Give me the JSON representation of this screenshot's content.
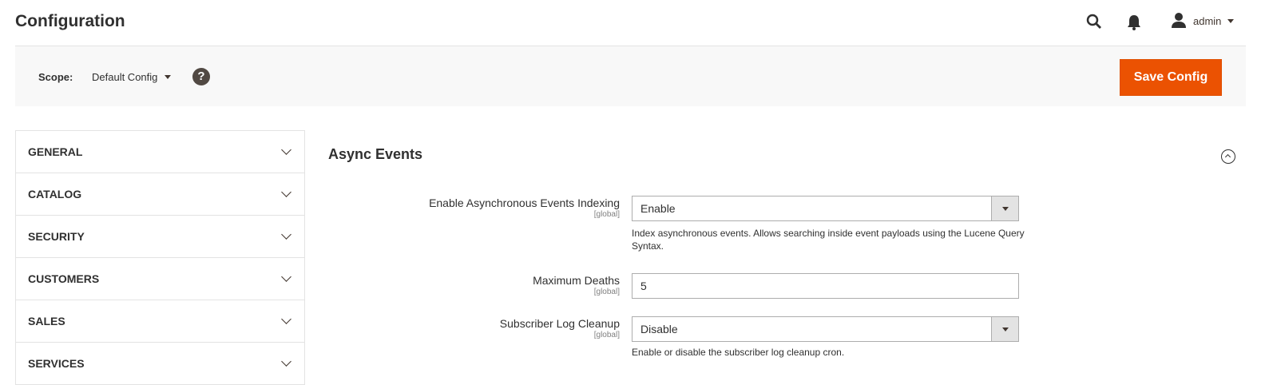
{
  "header": {
    "title": "Configuration",
    "user": "admin"
  },
  "scope": {
    "label": "Scope:",
    "value": "Default Config",
    "help": "?"
  },
  "actions": {
    "save": "Save Config"
  },
  "sidebar": {
    "items": [
      {
        "label": "GENERAL"
      },
      {
        "label": "CATALOG"
      },
      {
        "label": "SECURITY"
      },
      {
        "label": "CUSTOMERS"
      },
      {
        "label": "SALES"
      },
      {
        "label": "SERVICES"
      }
    ]
  },
  "section": {
    "title": "Async Events",
    "fields": [
      {
        "label": "Enable Asynchronous Events Indexing",
        "scope": "[global]",
        "value": "Enable",
        "note": "Index asynchronous events. Allows searching inside event payloads using the Lucene Query Syntax."
      },
      {
        "label": "Maximum Deaths",
        "scope": "[global]",
        "value": "5"
      },
      {
        "label": "Subscriber Log Cleanup",
        "scope": "[global]",
        "value": "Disable",
        "note": "Enable or disable the subscriber log cleanup cron."
      }
    ]
  }
}
